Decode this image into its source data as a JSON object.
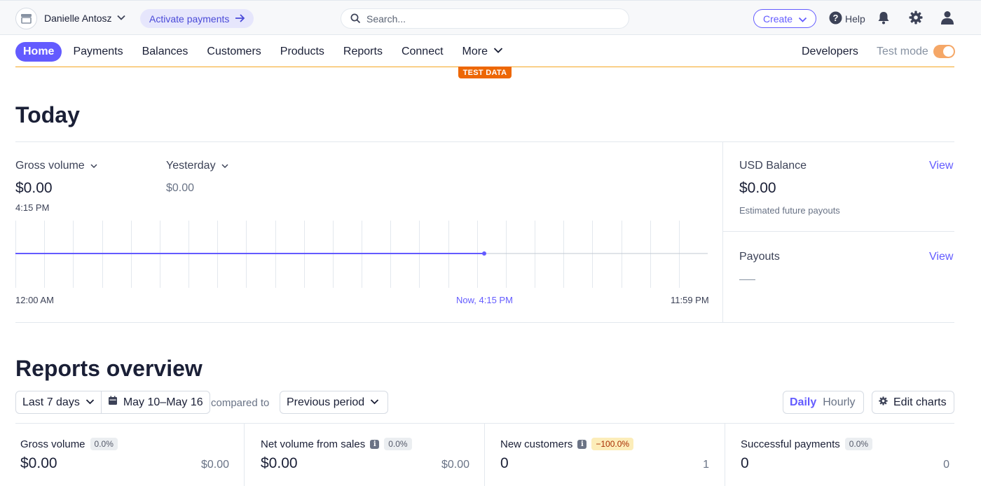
{
  "topbar": {
    "account_name": "Danielle Antosz",
    "activate_label": "Activate payments",
    "search_placeholder": "Search...",
    "create_label": "Create",
    "help_label": "Help"
  },
  "nav": {
    "items": [
      "Home",
      "Payments",
      "Balances",
      "Customers",
      "Products",
      "Reports",
      "Connect",
      "More"
    ],
    "developers": "Developers",
    "test_mode": "Test mode",
    "test_mode_on": true,
    "test_data_badge": "TEST DATA"
  },
  "today": {
    "title": "Today",
    "gross_label": "Gross volume",
    "gross_value": "$0.00",
    "gross_time": "4:15 PM",
    "compare_label": "Yesterday",
    "compare_value": "$0.00",
    "chart": {
      "start_label": "12:00 AM",
      "now_label": "Now, 4:15 PM",
      "end_label": "11:59 PM"
    },
    "balance": {
      "label": "USD Balance",
      "view": "View",
      "value": "$0.00",
      "sub": "Estimated future payouts"
    },
    "payouts": {
      "label": "Payouts",
      "view": "View"
    }
  },
  "reports": {
    "title": "Reports overview",
    "range": "Last 7 days",
    "dates": "May 10–May 16",
    "compared_to": "compared to",
    "period": "Previous period",
    "daily": "Daily",
    "hourly": "Hourly",
    "edit_charts": "Edit charts",
    "cards": [
      {
        "label": "Gross volume",
        "change": "0.0%",
        "value": "$0.00",
        "previous": "$0.00"
      },
      {
        "label": "Net volume from sales",
        "change": "0.0%",
        "value": "$0.00",
        "previous": "$0.00"
      },
      {
        "label": "New customers",
        "change": "−100.0%",
        "value": "0",
        "previous": "1"
      },
      {
        "label": "Successful payments",
        "change": "0.0%",
        "value": "0",
        "previous": "0"
      }
    ]
  },
  "colors": {
    "accent": "#635bff",
    "test_orange": "#ed6704",
    "toggle": "#f5a767",
    "warn_bg": "#fcedb9"
  }
}
